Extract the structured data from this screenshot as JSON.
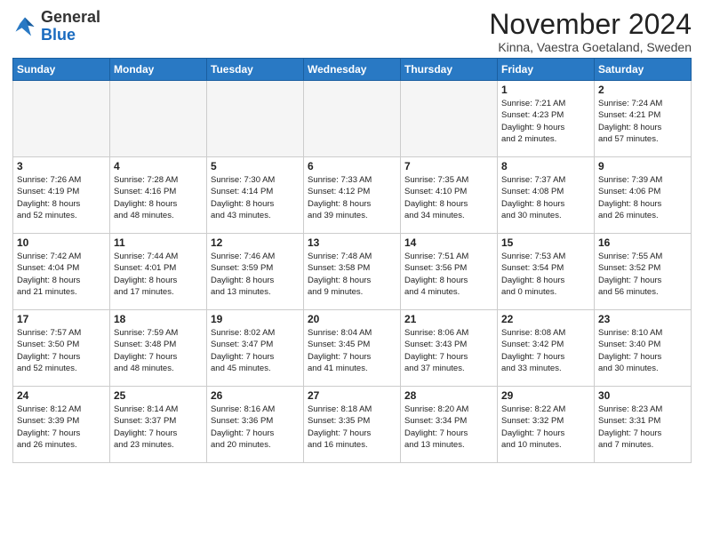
{
  "header": {
    "logo_general": "General",
    "logo_blue": "Blue",
    "month_title": "November 2024",
    "location": "Kinna, Vaestra Goetaland, Sweden"
  },
  "days_of_week": [
    "Sunday",
    "Monday",
    "Tuesday",
    "Wednesday",
    "Thursday",
    "Friday",
    "Saturday"
  ],
  "weeks": [
    [
      {
        "day": "",
        "empty": true
      },
      {
        "day": "",
        "empty": true
      },
      {
        "day": "",
        "empty": true
      },
      {
        "day": "",
        "empty": true
      },
      {
        "day": "",
        "empty": true
      },
      {
        "day": "1",
        "info": "Sunrise: 7:21 AM\nSunset: 4:23 PM\nDaylight: 9 hours\nand 2 minutes."
      },
      {
        "day": "2",
        "info": "Sunrise: 7:24 AM\nSunset: 4:21 PM\nDaylight: 8 hours\nand 57 minutes."
      }
    ],
    [
      {
        "day": "3",
        "info": "Sunrise: 7:26 AM\nSunset: 4:19 PM\nDaylight: 8 hours\nand 52 minutes."
      },
      {
        "day": "4",
        "info": "Sunrise: 7:28 AM\nSunset: 4:16 PM\nDaylight: 8 hours\nand 48 minutes."
      },
      {
        "day": "5",
        "info": "Sunrise: 7:30 AM\nSunset: 4:14 PM\nDaylight: 8 hours\nand 43 minutes."
      },
      {
        "day": "6",
        "info": "Sunrise: 7:33 AM\nSunset: 4:12 PM\nDaylight: 8 hours\nand 39 minutes."
      },
      {
        "day": "7",
        "info": "Sunrise: 7:35 AM\nSunset: 4:10 PM\nDaylight: 8 hours\nand 34 minutes."
      },
      {
        "day": "8",
        "info": "Sunrise: 7:37 AM\nSunset: 4:08 PM\nDaylight: 8 hours\nand 30 minutes."
      },
      {
        "day": "9",
        "info": "Sunrise: 7:39 AM\nSunset: 4:06 PM\nDaylight: 8 hours\nand 26 minutes."
      }
    ],
    [
      {
        "day": "10",
        "info": "Sunrise: 7:42 AM\nSunset: 4:04 PM\nDaylight: 8 hours\nand 21 minutes."
      },
      {
        "day": "11",
        "info": "Sunrise: 7:44 AM\nSunset: 4:01 PM\nDaylight: 8 hours\nand 17 minutes."
      },
      {
        "day": "12",
        "info": "Sunrise: 7:46 AM\nSunset: 3:59 PM\nDaylight: 8 hours\nand 13 minutes."
      },
      {
        "day": "13",
        "info": "Sunrise: 7:48 AM\nSunset: 3:58 PM\nDaylight: 8 hours\nand 9 minutes."
      },
      {
        "day": "14",
        "info": "Sunrise: 7:51 AM\nSunset: 3:56 PM\nDaylight: 8 hours\nand 4 minutes."
      },
      {
        "day": "15",
        "info": "Sunrise: 7:53 AM\nSunset: 3:54 PM\nDaylight: 8 hours\nand 0 minutes."
      },
      {
        "day": "16",
        "info": "Sunrise: 7:55 AM\nSunset: 3:52 PM\nDaylight: 7 hours\nand 56 minutes."
      }
    ],
    [
      {
        "day": "17",
        "info": "Sunrise: 7:57 AM\nSunset: 3:50 PM\nDaylight: 7 hours\nand 52 minutes."
      },
      {
        "day": "18",
        "info": "Sunrise: 7:59 AM\nSunset: 3:48 PM\nDaylight: 7 hours\nand 48 minutes."
      },
      {
        "day": "19",
        "info": "Sunrise: 8:02 AM\nSunset: 3:47 PM\nDaylight: 7 hours\nand 45 minutes."
      },
      {
        "day": "20",
        "info": "Sunrise: 8:04 AM\nSunset: 3:45 PM\nDaylight: 7 hours\nand 41 minutes."
      },
      {
        "day": "21",
        "info": "Sunrise: 8:06 AM\nSunset: 3:43 PM\nDaylight: 7 hours\nand 37 minutes."
      },
      {
        "day": "22",
        "info": "Sunrise: 8:08 AM\nSunset: 3:42 PM\nDaylight: 7 hours\nand 33 minutes."
      },
      {
        "day": "23",
        "info": "Sunrise: 8:10 AM\nSunset: 3:40 PM\nDaylight: 7 hours\nand 30 minutes."
      }
    ],
    [
      {
        "day": "24",
        "info": "Sunrise: 8:12 AM\nSunset: 3:39 PM\nDaylight: 7 hours\nand 26 minutes."
      },
      {
        "day": "25",
        "info": "Sunrise: 8:14 AM\nSunset: 3:37 PM\nDaylight: 7 hours\nand 23 minutes."
      },
      {
        "day": "26",
        "info": "Sunrise: 8:16 AM\nSunset: 3:36 PM\nDaylight: 7 hours\nand 20 minutes."
      },
      {
        "day": "27",
        "info": "Sunrise: 8:18 AM\nSunset: 3:35 PM\nDaylight: 7 hours\nand 16 minutes."
      },
      {
        "day": "28",
        "info": "Sunrise: 8:20 AM\nSunset: 3:34 PM\nDaylight: 7 hours\nand 13 minutes."
      },
      {
        "day": "29",
        "info": "Sunrise: 8:22 AM\nSunset: 3:32 PM\nDaylight: 7 hours\nand 10 minutes."
      },
      {
        "day": "30",
        "info": "Sunrise: 8:23 AM\nSunset: 3:31 PM\nDaylight: 7 hours\nand 7 minutes."
      }
    ]
  ]
}
